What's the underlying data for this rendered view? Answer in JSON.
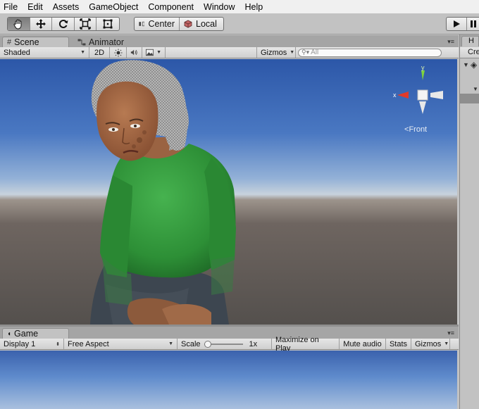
{
  "menubar": {
    "items": [
      "File",
      "Edit",
      "Assets",
      "GameObject",
      "Component",
      "Window",
      "Help"
    ]
  },
  "toolbar": {
    "transform_tools": [
      {
        "name": "hand-tool",
        "active": true
      },
      {
        "name": "move-tool",
        "active": false
      },
      {
        "name": "rotate-tool",
        "active": false
      },
      {
        "name": "scale-tool",
        "active": false
      },
      {
        "name": "rect-tool",
        "active": false
      }
    ],
    "pivot_label": "Center",
    "space_label": "Local"
  },
  "scene_panel": {
    "tabs": [
      {
        "label": "Scene",
        "active": true
      },
      {
        "label": "Animator",
        "active": false
      }
    ],
    "shading_mode": "Shaded",
    "mode_2d_label": "2D",
    "gizmos_label": "Gizmos",
    "search_placeholder": "All",
    "gizmo": {
      "x_label": "x",
      "y_label": "y",
      "view_label": "Front"
    }
  },
  "game_panel": {
    "tab_label": "Game",
    "display": "Display 1",
    "aspect": "Free Aspect",
    "scale_label": "Scale",
    "scale_value": "1x",
    "scale_slider_fraction": 0.0,
    "maximize_label": "Maximize on Play",
    "mute_label": "Mute audio",
    "stats_label": "Stats",
    "gizmos_label": "Gizmos"
  },
  "hierarchy": {
    "tab_initial": "H",
    "create_partial": "Cre"
  },
  "colors": {
    "hair": "#8f8f8f",
    "shirt": "#2f9a3a",
    "skin": "#a56b47",
    "pants": "#3d4650",
    "gizmo_x": "#e03a2a",
    "gizmo_y": "#7fd33b"
  }
}
